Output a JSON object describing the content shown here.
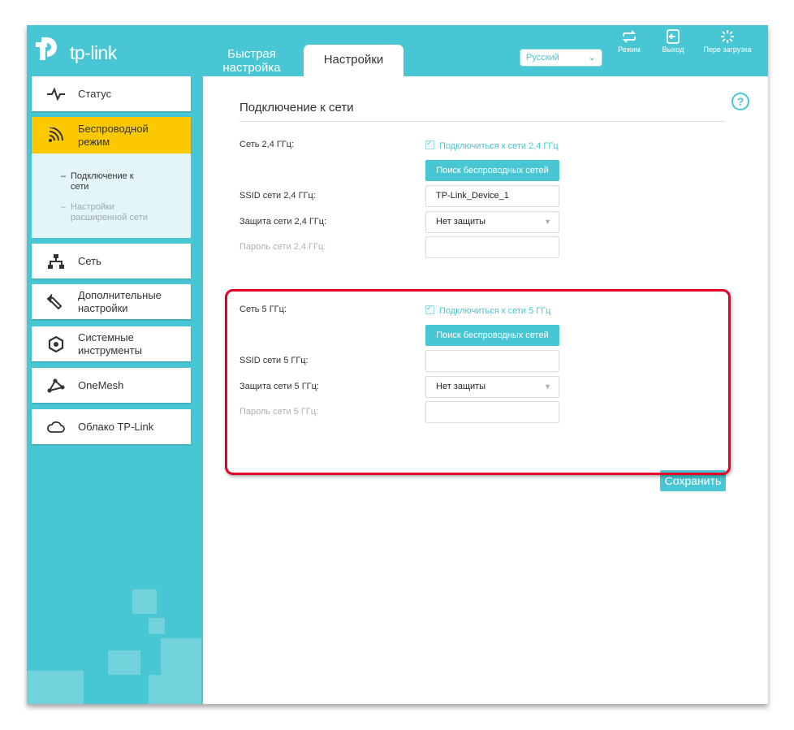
{
  "brand": {
    "logo_text": "tp-link"
  },
  "header": {
    "tab_quick_setup": "Быстрая настройка",
    "tab_settings": "Настройки",
    "language": "Русский",
    "tools": [
      {
        "label": "Режим",
        "icon": "mode-icon"
      },
      {
        "label": "Выход",
        "icon": "logout-icon"
      },
      {
        "label": "Пере загрузка",
        "icon": "reboot-icon"
      }
    ]
  },
  "sidebar": {
    "items": [
      {
        "label": "Статус",
        "icon": "status-icon"
      },
      {
        "label": "Беспроводной режим",
        "icon": "wireless-icon",
        "active": true
      },
      {
        "label": "Сеть",
        "icon": "network-icon"
      },
      {
        "label": "Дополнительные настройки",
        "icon": "advanced-icon"
      },
      {
        "label": "Системные инструменты",
        "icon": "system-tools-icon"
      },
      {
        "label": "OneMesh",
        "icon": "onemesh-icon"
      },
      {
        "label": "Облако TP-Link",
        "icon": "cloud-icon"
      }
    ],
    "submenu": [
      {
        "label": "Подключение к сети",
        "active": true
      },
      {
        "label": "Настройки расширенной сети",
        "active": false
      }
    ]
  },
  "main": {
    "section_title": "Подключение к сети",
    "band24": {
      "network_label": "Сеть 2,4 ГГц:",
      "connect_label": "Подключиться к сети 2,4 ГГц",
      "scan_button": "Поиск беспроводных сетей",
      "ssid_label": "SSID сети 2,4 ГГц:",
      "ssid_value": "TP-Link_Device_1",
      "security_label": "Защита сети 2,4 ГГц:",
      "security_value": "Нет защиты",
      "password_label": "Пароль сети 2,4 ГГц:",
      "password_value": ""
    },
    "band5": {
      "network_label": "Сеть 5 ГГц:",
      "connect_label": "Подключиться к сети 5 ГГц",
      "scan_button": "Поиск беспроводных сетей",
      "ssid_label": "SSID сети 5 ГГц:",
      "ssid_value": "",
      "security_label": "Защита сети 5 ГГц:",
      "security_value": "Нет защиты",
      "password_label": "Пароль сети 5 ГГц:",
      "password_value": ""
    },
    "save_button": "Сохранить"
  },
  "colors": {
    "accent": "#49c6d3",
    "active_nav": "#fcc800",
    "highlight": "#e5002a"
  }
}
